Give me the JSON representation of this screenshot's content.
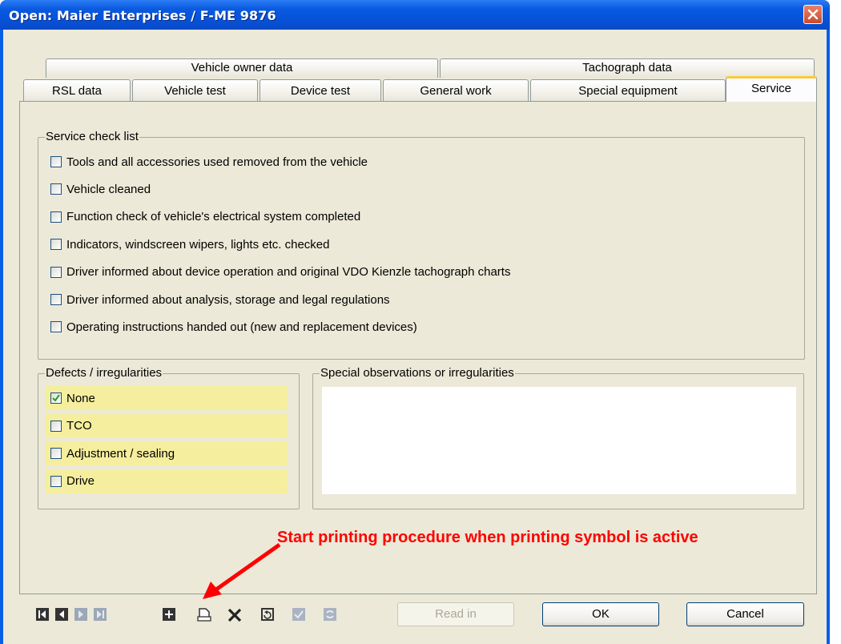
{
  "window": {
    "title": "Open: Maier Enterprises / F-ME 9876"
  },
  "tabs": {
    "top_row": [
      "Vehicle owner data",
      "Tachograph data"
    ],
    "bottom_row": [
      "RSL data",
      "Vehicle test",
      "Device test",
      "General work",
      "Special equipment",
      "Service"
    ],
    "active": "Service"
  },
  "service_checklist": {
    "title": "Service check list",
    "items": [
      {
        "label": "Tools and all accessories used removed from the vehicle",
        "checked": false
      },
      {
        "label": "Vehicle cleaned",
        "checked": false
      },
      {
        "label": "Function check of vehicle's electrical system completed",
        "checked": false
      },
      {
        "label": "Indicators, windscreen wipers, lights etc. checked",
        "checked": false
      },
      {
        "label": "Driver informed about device operation and original VDO Kienzle tachograph charts",
        "checked": false
      },
      {
        "label": "Driver informed about analysis, storage and legal regulations",
        "checked": false
      },
      {
        "label": "Operating instructions handed out (new and replacement devices)",
        "checked": false
      }
    ]
  },
  "defects": {
    "title": "Defects / irregularities",
    "items": [
      {
        "label": "None",
        "checked": true
      },
      {
        "label": "TCO",
        "checked": false
      },
      {
        "label": "Adjustment / sealing",
        "checked": false
      },
      {
        "label": "Drive",
        "checked": false
      }
    ]
  },
  "observations": {
    "title": "Special observations or irregularities",
    "value": ""
  },
  "annotation": {
    "text": "Start printing procedure when printing symbol is active",
    "color": "#ff0000"
  },
  "toolbar": {
    "icons": [
      "first-record-icon",
      "previous-record-icon",
      "next-record-icon",
      "last-record-icon",
      "add-record-icon",
      "print-icon",
      "delete-icon",
      "undo-icon",
      "confirm-icon",
      "refresh-icon"
    ]
  },
  "buttons": {
    "read_in": "Read in",
    "ok": "OK",
    "cancel": "Cancel"
  },
  "colors": {
    "titlebar": "#0a5fe6",
    "dialog_bg": "#ece9d8",
    "highlight_rows": "#f5ee9e",
    "active_tab_accent": "#ffc83c"
  }
}
